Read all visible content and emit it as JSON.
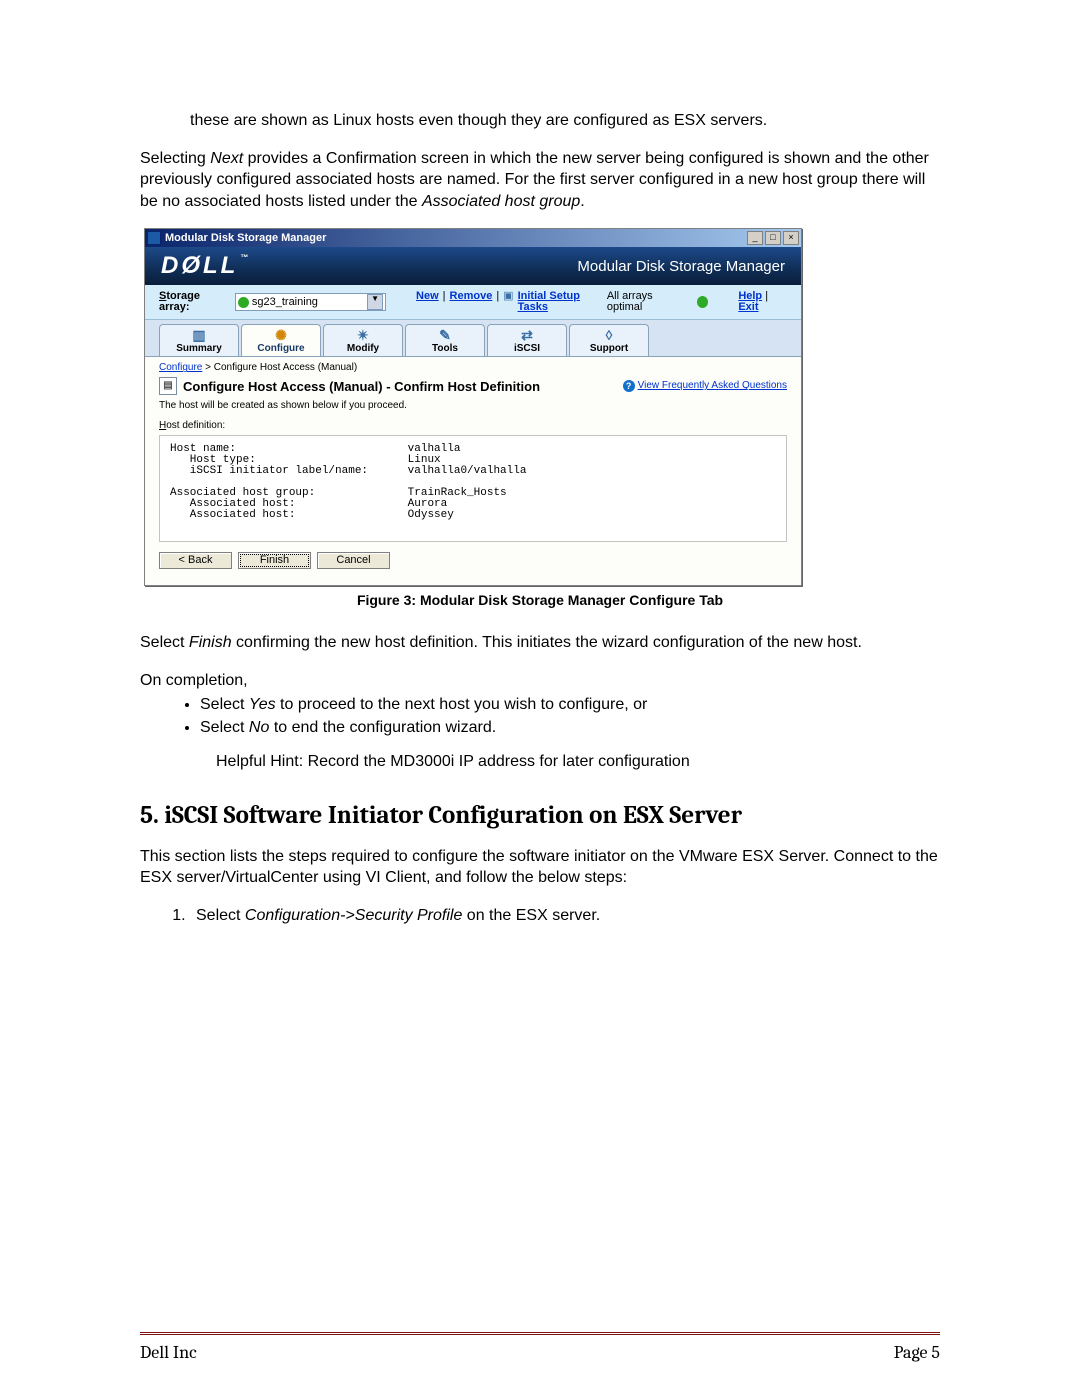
{
  "body": {
    "intro_line": "these are shown as Linux hosts even though they are configured as ESX servers.",
    "p2_a": "Selecting ",
    "p2_i": "Next",
    "p2_b": " provides a Confirmation screen in which the new server being configured is shown and the other previously configured associated hosts are named.   For the first server configured in a new host group there will be no associated hosts listed under the ",
    "p2_i2": "Associated host group",
    "p2_c": ".",
    "figure_caption": "Figure 3: Modular Disk Storage Manager Configure Tab",
    "p3_a": "Select ",
    "p3_i": "Finish",
    "p3_b": " confirming the new host definition.  This initiates the wizard configuration of the new host.",
    "p4": "On completion,",
    "bullet1_a": "Select ",
    "bullet1_i": "Yes",
    "bullet1_b": " to proceed to the next host you wish to configure, or",
    "bullet2_a": "Select ",
    "bullet2_i": "No",
    "bullet2_b": " to end the configuration wizard.",
    "hint": "Helpful Hint:   Record the MD3000i IP address for later configuration",
    "h5": "5. iSCSI Software Initiator Configuration on ESX Server",
    "p5": "This section lists the steps required to configure the software initiator on the VMware ESX Server. Connect to the ESX server/VirtualCenter using VI Client, and follow the below steps:",
    "step1_a": "Select ",
    "step1_i": "Configuration->Security Profile",
    "step1_b": " on the ESX server."
  },
  "app": {
    "win_title": "Modular Disk Storage Manager",
    "banner_logo": "DØLL",
    "banner_tm": "™",
    "banner_right": "Modular Disk Storage Manager",
    "storage_label": "Storage array:",
    "storage_value": "sg23_training",
    "link_new": "New",
    "link_remove": "Remove",
    "link_initial": "Initial Setup Tasks",
    "status_text": "All arrays optimal",
    "help": "Help",
    "exit": "Exit",
    "tabs": [
      "Summary",
      "Configure",
      "Modify",
      "Tools",
      "iSCSI",
      "Support"
    ],
    "breadcrumb_link": "Configure",
    "breadcrumb_rest": "  Configure Host Access (Manual)",
    "section_title": "Configure Host Access (Manual) - Confirm Host Definition",
    "faq": "View Frequently Asked Questions",
    "subtext": "The host will be created as shown below if you proceed.",
    "hostdef_label": "Host definition:",
    "hostdef_text": "Host name:                          valhalla\n   Host type:                       Linux\n   iSCSI initiator label/name:      valhalla0/valhalla\n\nAssociated host group:              TrainRack_Hosts\n   Associated host:                 Aurora\n   Associated host:                 Odyssey",
    "btn_back": "< Back",
    "btn_finish": "Finish",
    "btn_cancel": "Cancel"
  },
  "footer": {
    "left": "Dell Inc",
    "right": "Page 5"
  }
}
